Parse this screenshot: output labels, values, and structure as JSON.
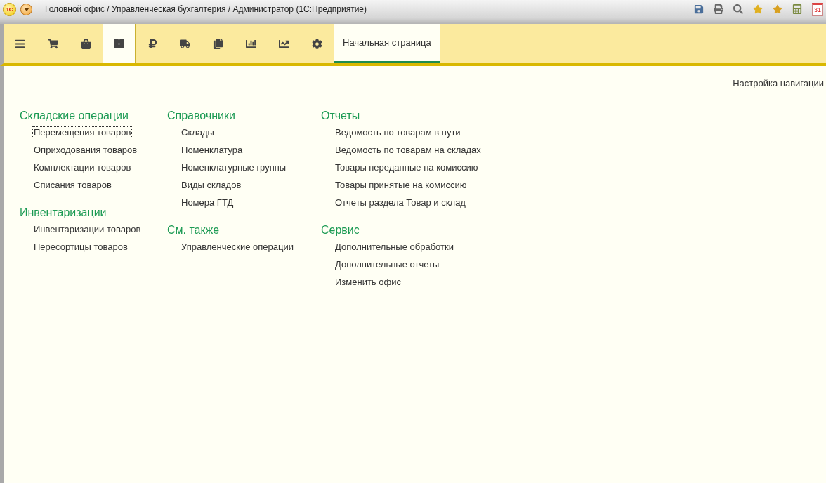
{
  "window": {
    "logo": "1С",
    "title": "Головной офис / Управленческая бухгалтерия / Администратор  (1С:Предприятие)",
    "tools": [
      {
        "kind": "save"
      },
      {
        "kind": "print"
      },
      {
        "kind": "preview"
      },
      {
        "kind": "favorite-add"
      },
      {
        "kind": "favorites"
      },
      {
        "kind": "calculator"
      },
      {
        "kind": "calendar",
        "label": "31"
      }
    ]
  },
  "sections": [
    {
      "kind": "menu",
      "selected": false
    },
    {
      "kind": "cart",
      "selected": false
    },
    {
      "kind": "bag",
      "selected": false
    },
    {
      "kind": "grid",
      "selected": true
    },
    {
      "kind": "ruble",
      "selected": false
    },
    {
      "kind": "truck",
      "selected": false
    },
    {
      "kind": "copies",
      "selected": false
    },
    {
      "kind": "bars",
      "selected": false
    },
    {
      "kind": "trend",
      "selected": false
    },
    {
      "kind": "gear",
      "selected": false
    }
  ],
  "tabs": [
    {
      "label": "Начальная страница",
      "selected": true
    }
  ],
  "nav_settings": "Настройка навигации",
  "columns": [
    [
      {
        "title": "Складские операции",
        "links": [
          {
            "label": "Перемещения товаров",
            "focused": true
          },
          {
            "label": "Оприходования товаров",
            "focused": false
          },
          {
            "label": "Комплектации товаров",
            "focused": false
          },
          {
            "label": "Списания товаров",
            "focused": false
          }
        ]
      },
      {
        "title": "Инвентаризации",
        "links": [
          {
            "label": "Инвентаризации товаров",
            "focused": false
          },
          {
            "label": "Пересортицы товаров",
            "focused": false
          }
        ]
      }
    ],
    [
      {
        "title": "Справочники",
        "links": [
          {
            "label": "Склады",
            "focused": false
          },
          {
            "label": "Номенклатура",
            "focused": false
          },
          {
            "label": "Номенклатурные группы",
            "focused": false
          },
          {
            "label": "Виды складов",
            "focused": false
          },
          {
            "label": "Номера ГТД",
            "focused": false
          }
        ]
      },
      {
        "title": "См. также",
        "links": [
          {
            "label": "Управленческие операции",
            "focused": false
          }
        ]
      }
    ],
    [
      {
        "title": "Отчеты",
        "links": [
          {
            "label": "Ведомость по товарам в пути",
            "focused": false
          },
          {
            "label": "Ведомость по товарам на складах",
            "focused": false
          },
          {
            "label": "Товары переданные на комиссию",
            "focused": false
          },
          {
            "label": "Товары принятые на комиссию",
            "focused": false
          },
          {
            "label": "Отчеты раздела Товар и склад",
            "focused": false
          }
        ]
      },
      {
        "title": "Сервис",
        "links": [
          {
            "label": "Дополнительные обработки",
            "focused": false
          },
          {
            "label": "Дополнительные отчеты",
            "focused": false
          },
          {
            "label": "Изменить офис",
            "focused": false
          }
        ]
      }
    ]
  ]
}
